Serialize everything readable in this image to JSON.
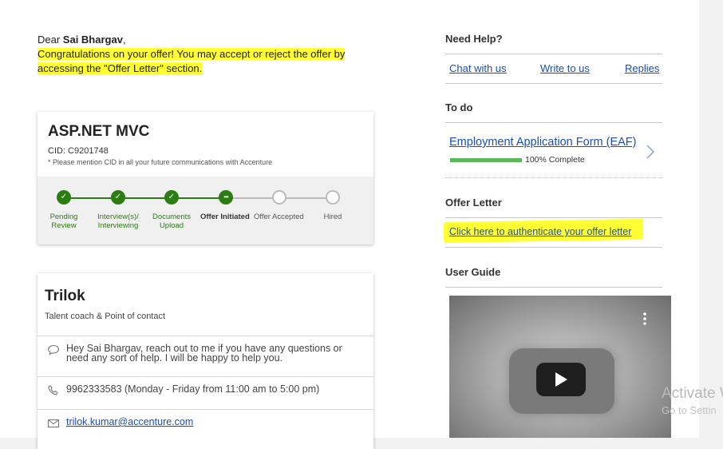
{
  "greeting": {
    "dear": "Dear ",
    "name": "Sai Bhargav",
    "comma": ",",
    "message_line1": "Congratulations on your offer! You may accept or reject the offer by",
    "message_line2": "accessing the \"Offer Letter\" section."
  },
  "application": {
    "title": "ASP.NET MVC",
    "cid": "CID: C9201748",
    "cid_note": "* Please mention CID in all your future communications with Accenture",
    "steps": [
      {
        "label_line1": "Pending",
        "label_line2": "Review",
        "status": "done"
      },
      {
        "label_line1": "Interview(s)/",
        "label_line2": "Interviewing",
        "status": "done"
      },
      {
        "label_line1": "Documents",
        "label_line2": "Upload",
        "status": "done"
      },
      {
        "label_line1": "Offer Initiated",
        "label_line2": "",
        "status": "current"
      },
      {
        "label_line1": "Offer Accepted",
        "label_line2": "",
        "status": "todo"
      },
      {
        "label_line1": "Hired",
        "label_line2": "",
        "status": "todo"
      }
    ],
    "colors": {
      "done": "#2b7d12",
      "todo": "#bbbbbb",
      "current_dots": "•••",
      "check": "✓"
    }
  },
  "contact": {
    "name": "Trilok",
    "role": "Talent coach & Point of contact",
    "message": "Hey Sai Bhargav, reach out to me if you have any questions or need any sort of help. I will be happy to help you.",
    "phone": "9962333583 (Monday - Friday from 11:00 am to 5:00 pm)",
    "email": "trilok.kumar@accenture.com",
    "icons": {
      "message": "chat-bubble-icon",
      "phone": "phone-icon",
      "email": "envelope-icon"
    }
  },
  "sidebar": {
    "need_help": {
      "heading": "Need Help?",
      "links": [
        "Chat with us",
        "Write to us",
        "Replies"
      ]
    },
    "todo": {
      "heading": "To do",
      "item_label": "Employment Application Form (EAF)",
      "progress_text": "100% Complete",
      "progress_fraction": 1.0
    },
    "offer_letter": {
      "heading": "Offer Letter",
      "link": "Click here to authenticate your offer letter"
    },
    "user_guide": {
      "heading": "User Guide",
      "video_icons": [
        "play-icon",
        "more-vertical-icon"
      ]
    }
  },
  "watermark": {
    "line1": "Activate W",
    "line2": "Go to Settin"
  }
}
